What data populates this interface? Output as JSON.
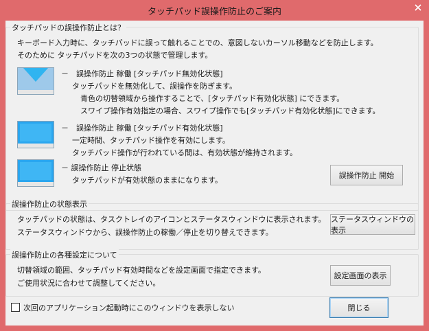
{
  "window": {
    "title": "タッチパッド誤操作防止のご案内",
    "accent": "#e06a6c"
  },
  "intro": {
    "heading": "タッチパッドの誤操作防止とは？",
    "line1": "キーボード入力時に、タッチパッドに誤って触れることでの、意図しないカーソル移動などを防止します。",
    "line2": "そのために タッチパッドを次の3つの状態で管理します。"
  },
  "states": [
    {
      "icon": "touchpad-disabled-icon",
      "title": "－　誤操作防止 稼働 [タッチパッド無効化状態]",
      "lines": [
        "タッチパッドを無効化して、誤操作を防ぎます。",
        "青色の切替領域から操作することで、[タッチパッド有効化状態] にできます。",
        "スワイプ操作有効指定の場合、スワイプ操作でも[タッチパッド有効化状態]にできます。"
      ]
    },
    {
      "icon": "touchpad-enabled-icon",
      "title": "－　誤操作防止 稼働 [タッチパッド有効化状態]",
      "lines": [
        "一定時間、タッチパッド操作を有効にします。",
        "タッチパッド操作が行われている間は、有効状態が維持されます。"
      ]
    },
    {
      "icon": "touchpad-stopped-icon",
      "title": "－ 誤操作防止 停止状態",
      "lines": [
        "タッチパッドが有効状態のままになります。"
      ]
    }
  ],
  "start_button": "誤操作防止 開始",
  "status_section": {
    "legend": "誤操作防止の状態表示",
    "line1": "タッチパッドの状態は、タスクトレイのアイコンとステータスウィンドウに表示されます。",
    "line2": "ステータスウィンドウから、誤操作防止の稼働／停止を切り替えできます。",
    "button": "ステータスウィンドウの表示"
  },
  "settings_section": {
    "legend": "誤操作防止の各種設定について",
    "line1": "切替領域の範囲、タッチパッド有効時間などを設定画面で指定できます。",
    "line2": "ご使用状況に合わせて調整してください。",
    "button": "設定画面の表示"
  },
  "footer": {
    "checkbox_label": "次回のアプリケーション起動時にこのウィンドウを表示しない",
    "checkbox_checked": false,
    "close_button": "閉じる"
  }
}
